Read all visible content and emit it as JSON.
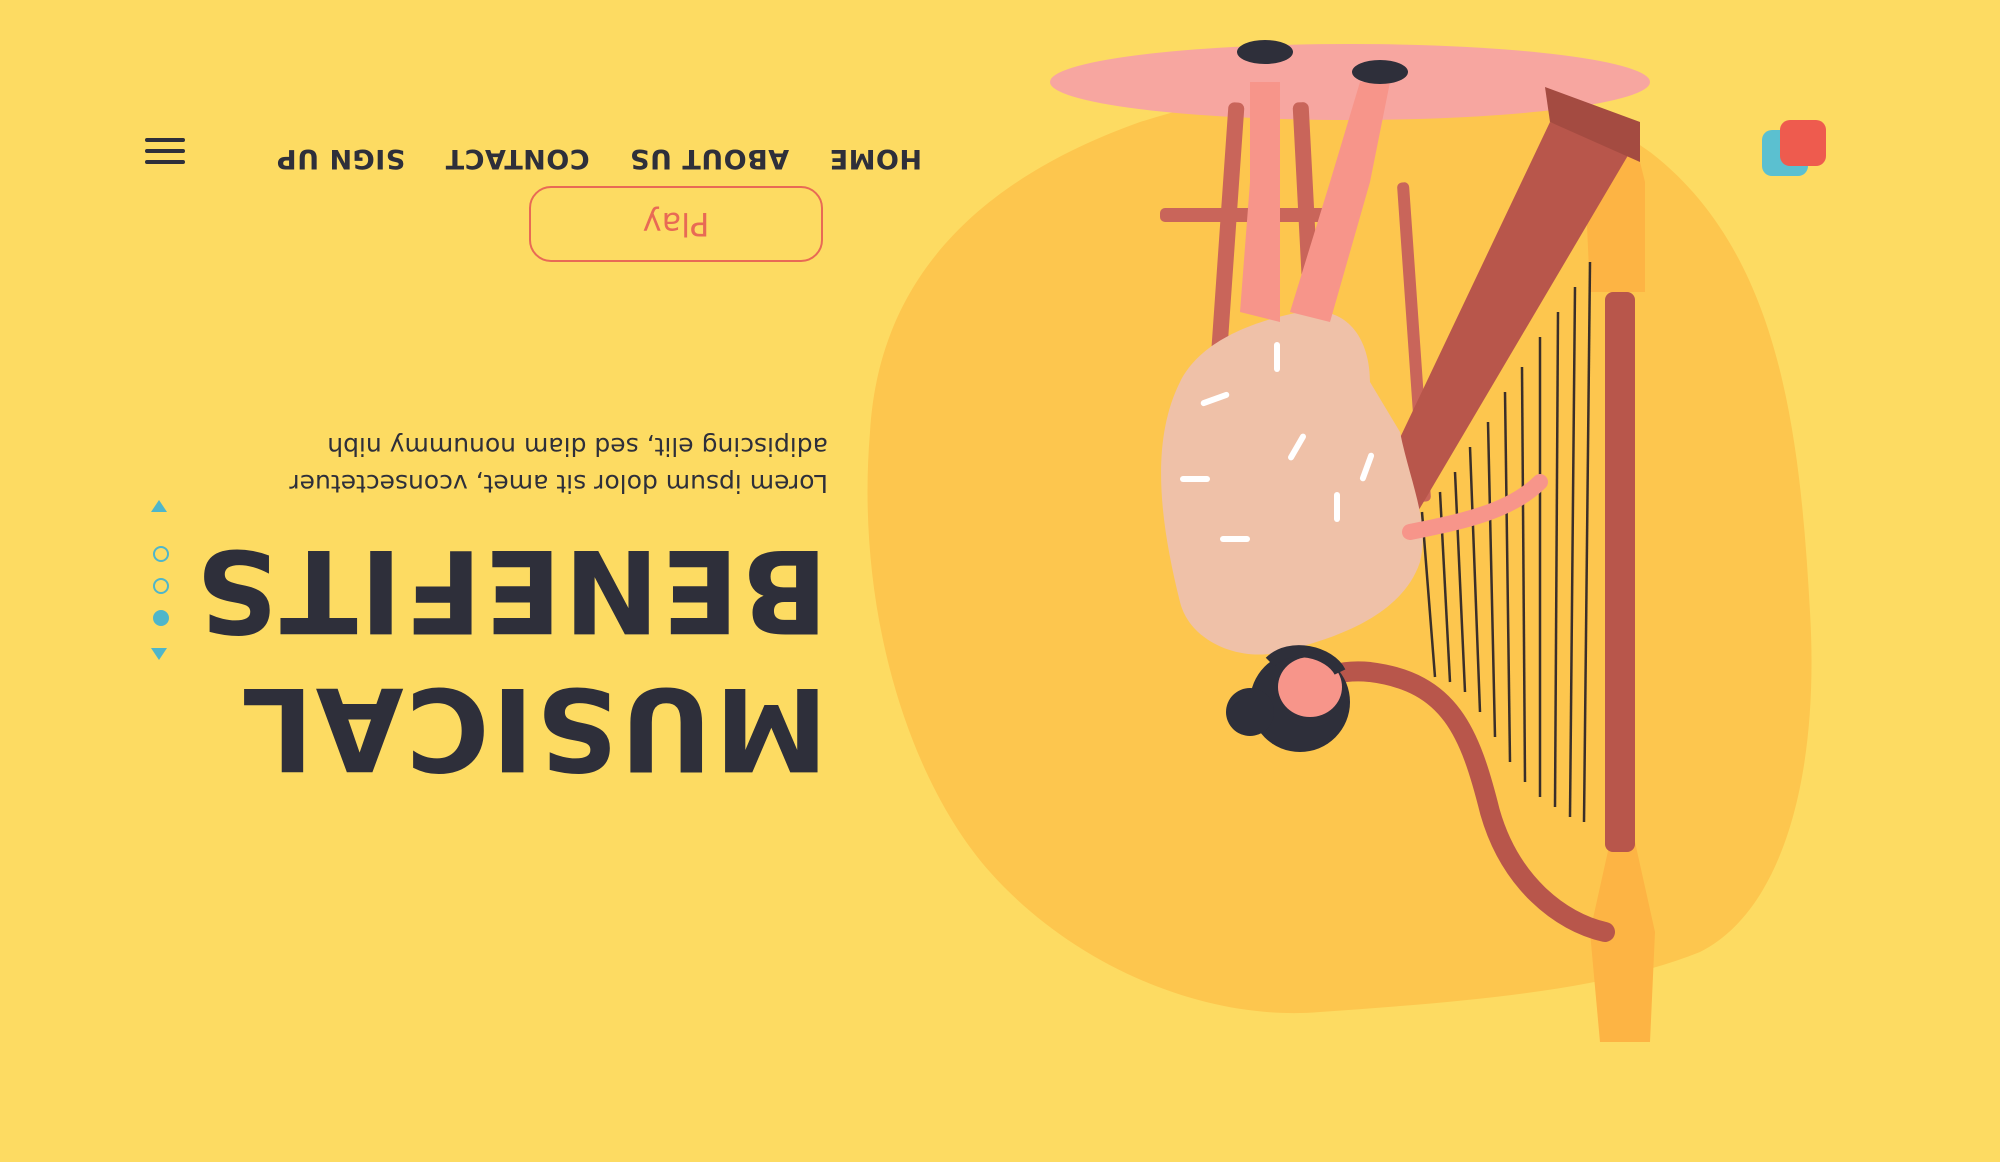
{
  "nav": {
    "items": [
      "HOME",
      "ABOUT US",
      "CONTACT",
      "SIGN UP"
    ]
  },
  "hero": {
    "title_line1": "MUSICAL",
    "title_line2": "BENEFITS",
    "body": "Lorem ipsum dolor sit amet, vconsectetuer adipiscing elit, sed diam nonummy nibh",
    "play_label": "Play"
  },
  "slider": {
    "dot_count": 3,
    "active_index": 2
  },
  "icons": {
    "logo": "logo-icon",
    "menu": "hamburger-menu-icon",
    "prev": "triangle-up-icon",
    "next": "triangle-down-icon"
  },
  "colors": {
    "background": "#FDDB62",
    "text_dark": "#2E2F3A",
    "accent_red": "#E86A55",
    "accent_teal": "#4FB6CA",
    "blob": "#FDC64E"
  }
}
